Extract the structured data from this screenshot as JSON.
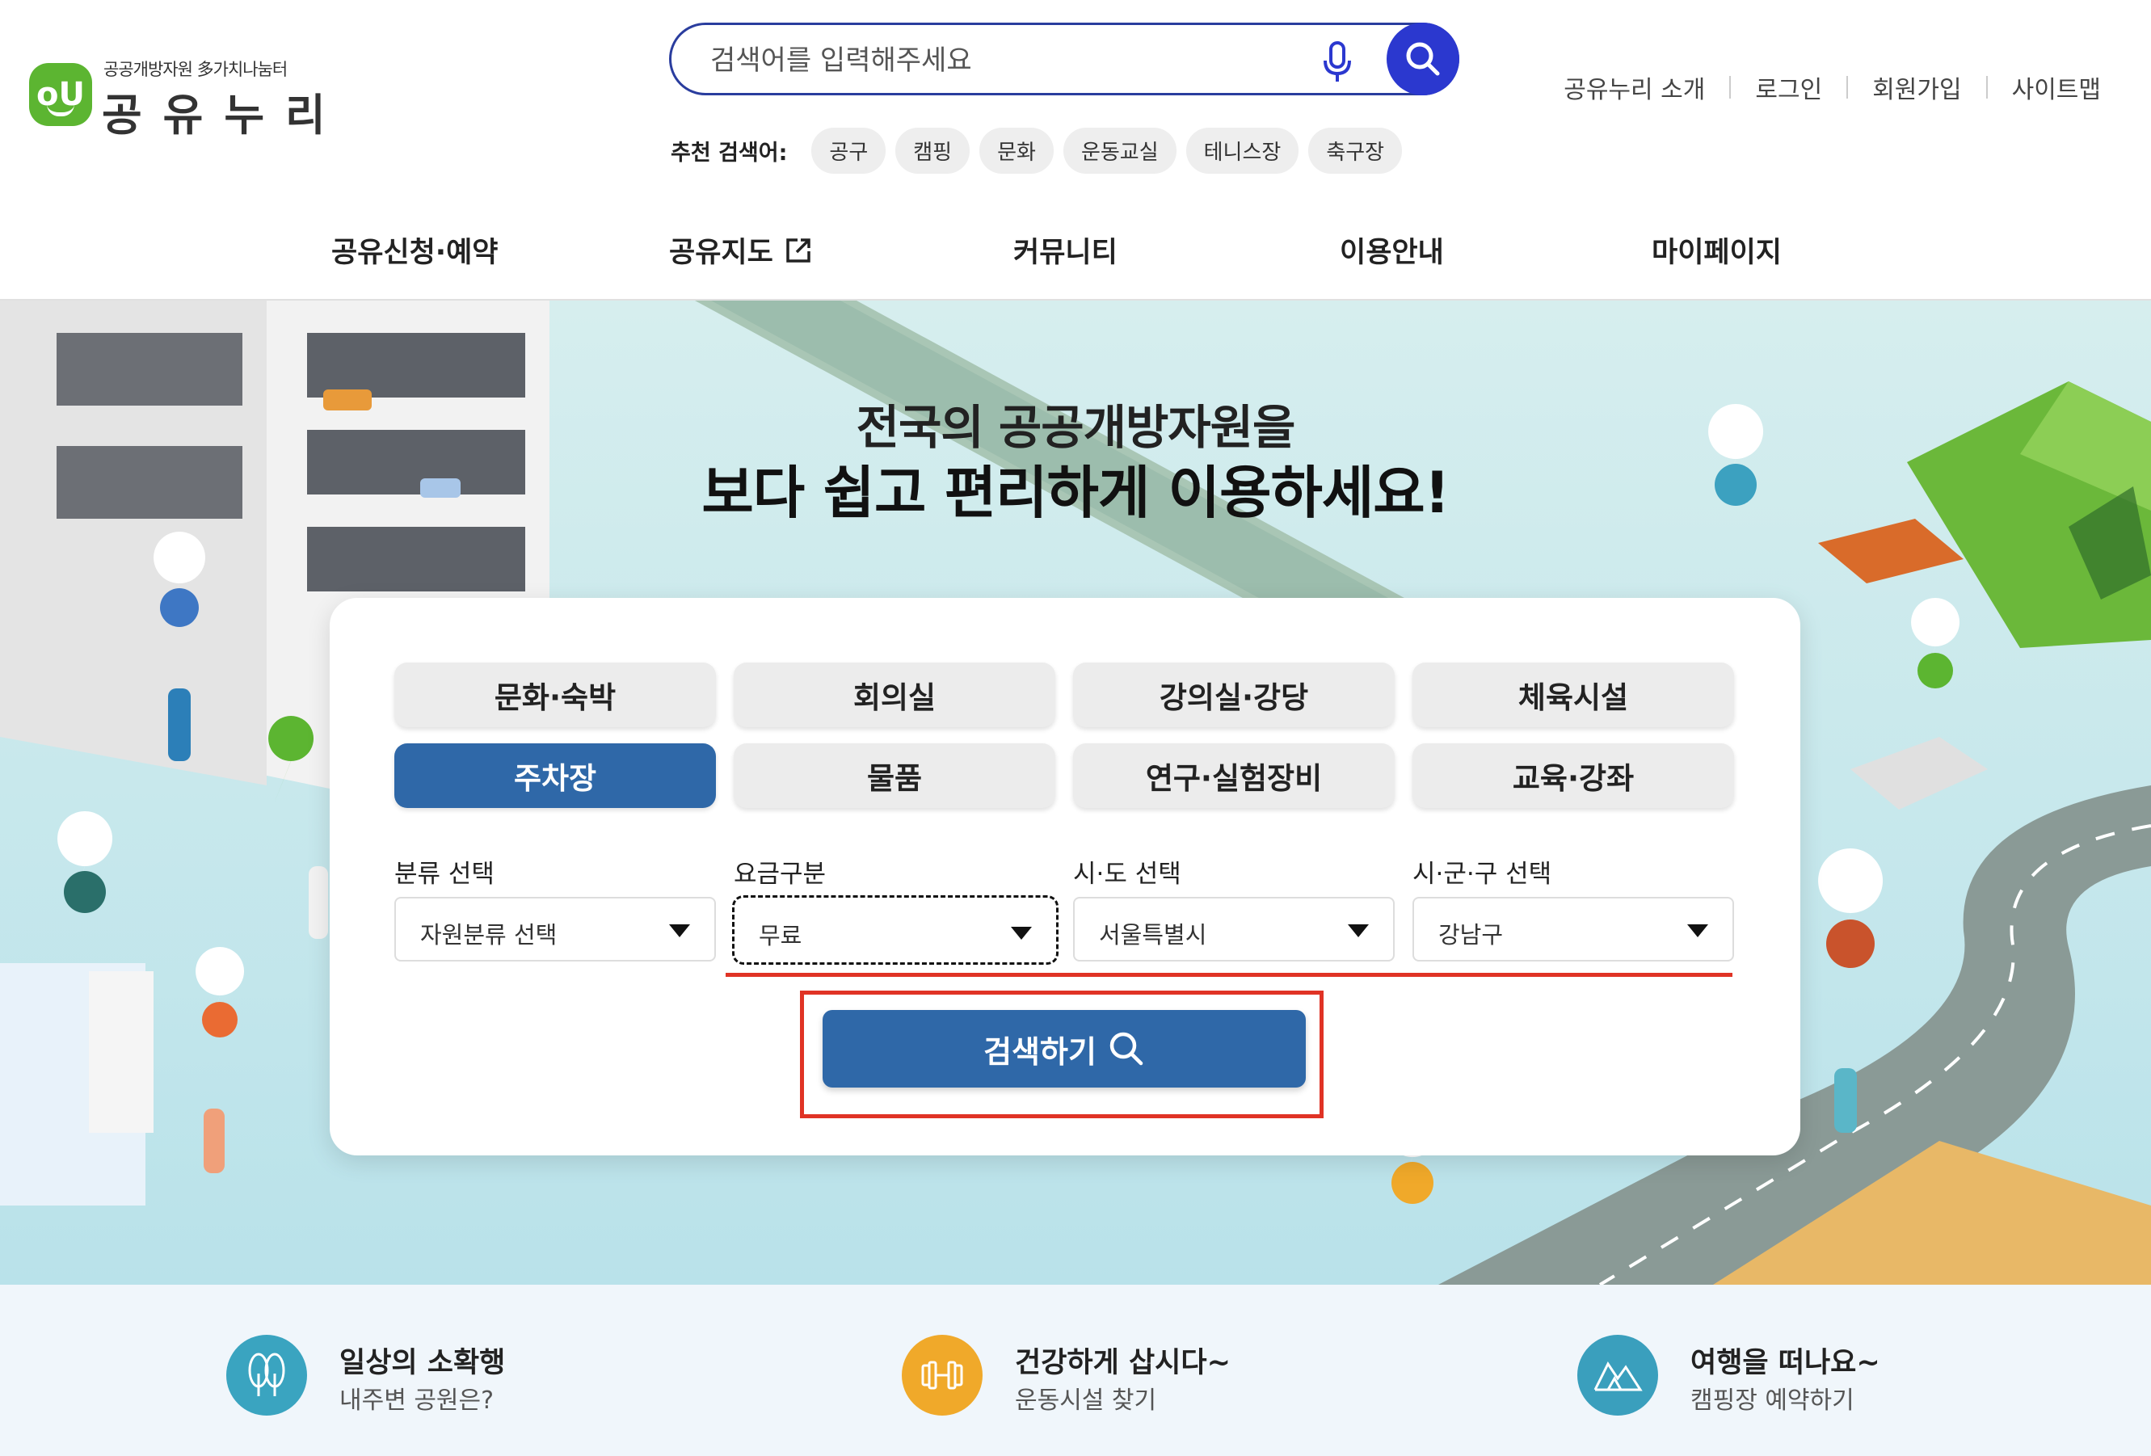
{
  "logo": {
    "subtitle": "공공개방자원 多가치나눔터",
    "name": "공유누리"
  },
  "search": {
    "placeholder": "검색어를 입력해주세요"
  },
  "recommended": {
    "label": "추천 검색어:",
    "tags": [
      "공구",
      "캠핑",
      "문화",
      "운동교실",
      "테니스장",
      "축구장"
    ]
  },
  "util_nav": [
    "공유누리 소개",
    "로그인",
    "회원가입",
    "사이트맵"
  ],
  "gnb": [
    "공유신청·예약",
    "공유지도",
    "커뮤니티",
    "이용안내",
    "마이페이지"
  ],
  "hero": {
    "line1": "전국의 공공개방자원을",
    "line2": "보다 쉽고 편리하게 이용하세요!"
  },
  "categories": {
    "row1": [
      "문화·숙박",
      "회의실",
      "강의실·강당",
      "체육시설"
    ],
    "row2": [
      "주차장",
      "물품",
      "연구·실험장비",
      "교육·강좌"
    ],
    "active": "주차장"
  },
  "filters": [
    {
      "label": "분류 선택",
      "value": "자원분류 선택"
    },
    {
      "label": "요금구분",
      "value": "무료"
    },
    {
      "label": "시·도 선택",
      "value": "서울특별시"
    },
    {
      "label": "시·군·구 선택",
      "value": "강남구"
    }
  ],
  "submit_label": "검색하기",
  "quick_links": [
    {
      "title": "일상의 소확행",
      "subtitle": "내주변 공원은?",
      "color": "#3aa4c0",
      "icon": "park-icon"
    },
    {
      "title": "건강하게 삽시다~",
      "subtitle": "운동시설 찾기",
      "color": "#f0a92a",
      "icon": "dumbbell-icon"
    },
    {
      "title": "여행을 떠나요~",
      "subtitle": "캠핑장 예약하기",
      "color": "#3a9fbd",
      "icon": "camping-icon"
    }
  ],
  "colors": {
    "primary": "#2f68a8",
    "search_blue": "#2b38cf",
    "highlight_red": "#e03325",
    "brand_green": "#5cb531"
  }
}
